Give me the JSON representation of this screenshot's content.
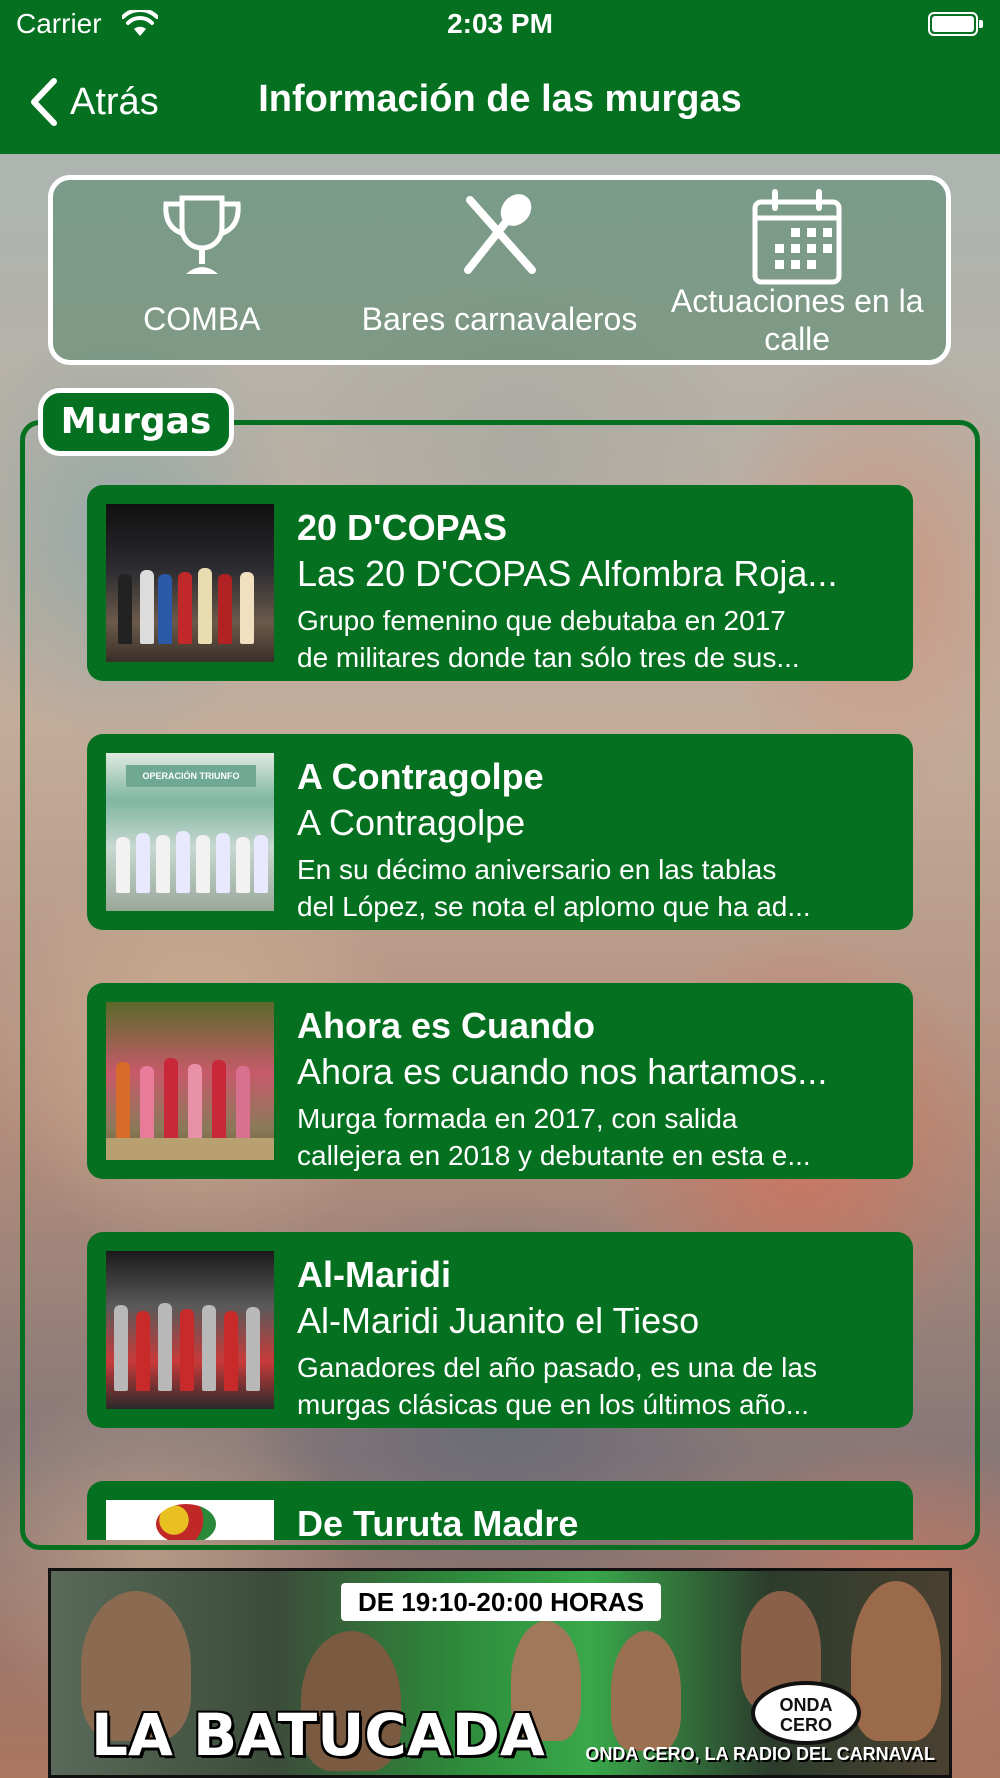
{
  "status_bar": {
    "carrier": "Carrier",
    "time": "2:03 PM",
    "icons": [
      "wifi-icon",
      "battery-icon"
    ]
  },
  "nav": {
    "back_label": "Atrás",
    "title": "Información de las murgas"
  },
  "menu": [
    {
      "label": "COMBA",
      "icon": "trophy-icon"
    },
    {
      "label": "Bares carnavaleros",
      "icon": "utensils-icon"
    },
    {
      "label": "Actuaciones en la calle",
      "icon": "calendar-icon"
    }
  ],
  "section": {
    "tab_label": "Murgas"
  },
  "murgas": [
    {
      "name": "20 D'COPAS",
      "subtitle": "Las 20 D'COPAS Alfombra Roja...",
      "desc_line1": "Grupo femenino que debutaba en 2017",
      "desc_line2": "de militares donde tan sólo tres de sus..."
    },
    {
      "name": "A Contragolpe",
      "subtitle": "A Contragolpe",
      "desc_line1": "En su décimo aniversario en las tablas",
      "desc_line2": "del López, se nota el aplomo que ha ad...",
      "thumb_sign": "OPERACIÓN TRIUNFO"
    },
    {
      "name": "Ahora es Cuando",
      "subtitle": "Ahora es cuando nos hartamos...",
      "desc_line1": "Murga formada en 2017, con salida",
      "desc_line2": "callejera en 2018 y debutante en esta e..."
    },
    {
      "name": "Al-Maridi",
      "subtitle": "Al-Maridi Juanito el Tieso",
      "desc_line1": "Ganadores del año pasado, es una de las",
      "desc_line2": "murgas clásicas que en los últimos año..."
    },
    {
      "name": "De Turuta Madre",
      "subtitle": "",
      "desc_line1": "",
      "desc_line2": ""
    }
  ],
  "banner": {
    "schedule": "DE 19:10-20:00 HORAS",
    "title": "LA BATUCADA",
    "tagline": "ONDA CERO, LA RADIO DEL CARNAVAL",
    "logo_text": "ONDA CERO"
  },
  "colors": {
    "primary_green": "#047020",
    "white": "#ffffff"
  }
}
